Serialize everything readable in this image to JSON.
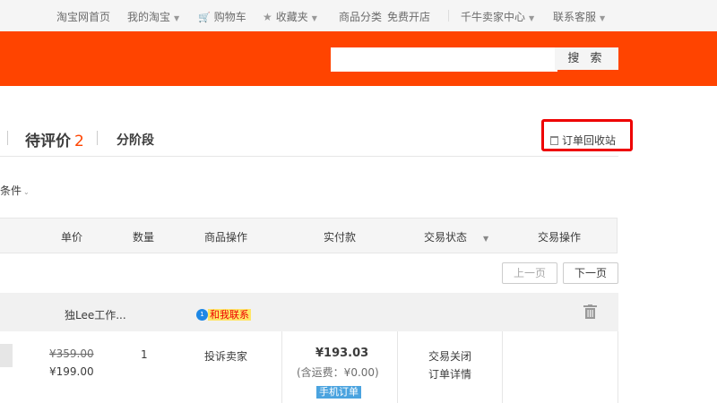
{
  "topnav": {
    "home": "淘宝网首页",
    "my_taobao": "我的淘宝",
    "cart": "购物车",
    "favorites": "收藏夹",
    "categories": "商品分类",
    "open_shop": "免费开店",
    "seller_center": "千牛卖家中心",
    "customer_service": "联系客服"
  },
  "search": {
    "placeholder": "",
    "button": "搜 索"
  },
  "tabs": {
    "to_review_label": "待评价",
    "to_review_count": "2",
    "stage_label": "分阶段",
    "recycle_bin": "订单回收站"
  },
  "filter": {
    "conditions": "条件"
  },
  "table_header": {
    "unit_price": "单价",
    "quantity": "数量",
    "item_actions": "商品操作",
    "paid": "实付款",
    "trade_status": "交易状态",
    "trade_actions": "交易操作"
  },
  "pager": {
    "prev": "上一页",
    "next": "下一页"
  },
  "order": {
    "shop_name": "独Lee工作...",
    "contact": "和我联系",
    "contact_badge": "1",
    "original_price": "¥359.00",
    "price": "¥199.00",
    "quantity": "1",
    "complain": "投诉卖家",
    "paid_amount": "¥193.03",
    "shipping_note": "(含运费：¥0.00)",
    "mobile_order": "手机订单",
    "status": "交易关闭",
    "details": "订单详情"
  },
  "colors": {
    "brand_orange": "#ff4400",
    "highlight_red": "#e00000",
    "mobile_badge": "#4aa3df"
  }
}
